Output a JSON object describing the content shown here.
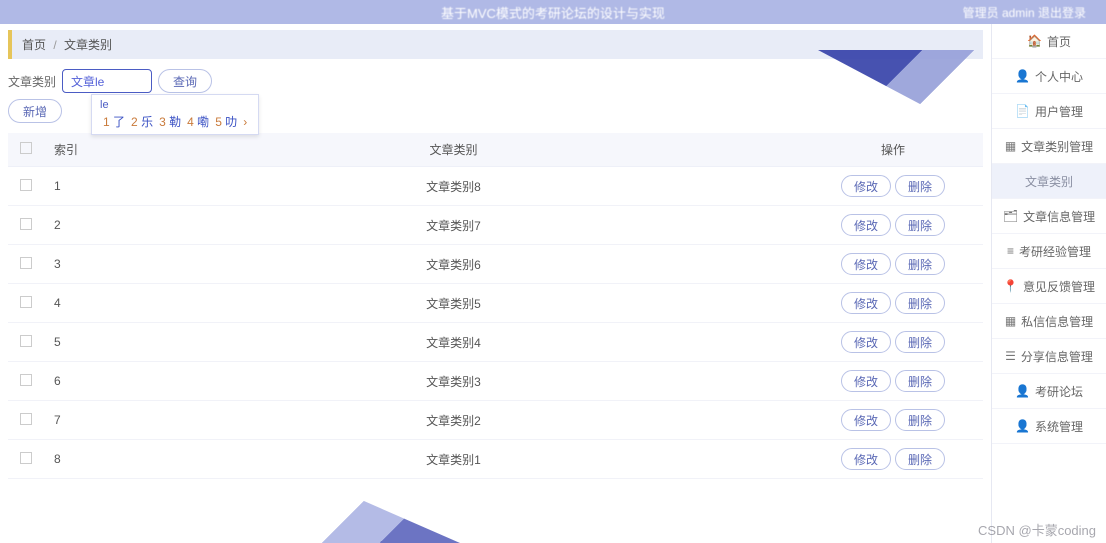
{
  "header": {
    "title": "基于MVC模式的考研论坛的设计与实现",
    "right_prefix": "管理员",
    "right_admin": "admin",
    "right_logout": "退出登录"
  },
  "breadcrumb": {
    "home": "首页",
    "current": "文章类别"
  },
  "filter": {
    "label": "文章类别",
    "input_value": "文章le",
    "search_btn": "查询",
    "add_btn": "新增"
  },
  "ime": {
    "typed": "le",
    "candidates": [
      {
        "idx": "1",
        "char": "了"
      },
      {
        "idx": "2",
        "char": "乐"
      },
      {
        "idx": "3",
        "char": "勒"
      },
      {
        "idx": "4",
        "char": "嘞"
      },
      {
        "idx": "5",
        "char": "叻"
      }
    ]
  },
  "table": {
    "headers": {
      "index": "索引",
      "category": "文章类别",
      "ops": "操作"
    },
    "op_edit": "修改",
    "op_delete": "删除",
    "rows": [
      {
        "idx": "1",
        "name": "文章类别8"
      },
      {
        "idx": "2",
        "name": "文章类别7"
      },
      {
        "idx": "3",
        "name": "文章类别6"
      },
      {
        "idx": "4",
        "name": "文章类别5"
      },
      {
        "idx": "5",
        "name": "文章类别4"
      },
      {
        "idx": "6",
        "name": "文章类别3"
      },
      {
        "idx": "7",
        "name": "文章类别2"
      },
      {
        "idx": "8",
        "name": "文章类别1"
      }
    ]
  },
  "sidebar": {
    "items": [
      {
        "icon": "🏠",
        "label": "首页"
      },
      {
        "icon": "👤",
        "label": "个人中心"
      },
      {
        "icon": "📄",
        "label": "用户管理"
      },
      {
        "icon": "▦",
        "label": "文章类别管理"
      },
      {
        "icon": "",
        "label": "文章类别",
        "sub": true
      },
      {
        "icon": "🗂",
        "label": "文章信息管理"
      },
      {
        "icon": "≡",
        "label": "考研经验管理"
      },
      {
        "icon": "📍",
        "label": "意见反馈管理"
      },
      {
        "icon": "▦",
        "label": "私信信息管理"
      },
      {
        "icon": "☰",
        "label": "分享信息管理"
      },
      {
        "icon": "👤",
        "label": "考研论坛"
      },
      {
        "icon": "👤",
        "label": "系统管理"
      }
    ]
  },
  "watermark": "CSDN @卡蒙coding"
}
